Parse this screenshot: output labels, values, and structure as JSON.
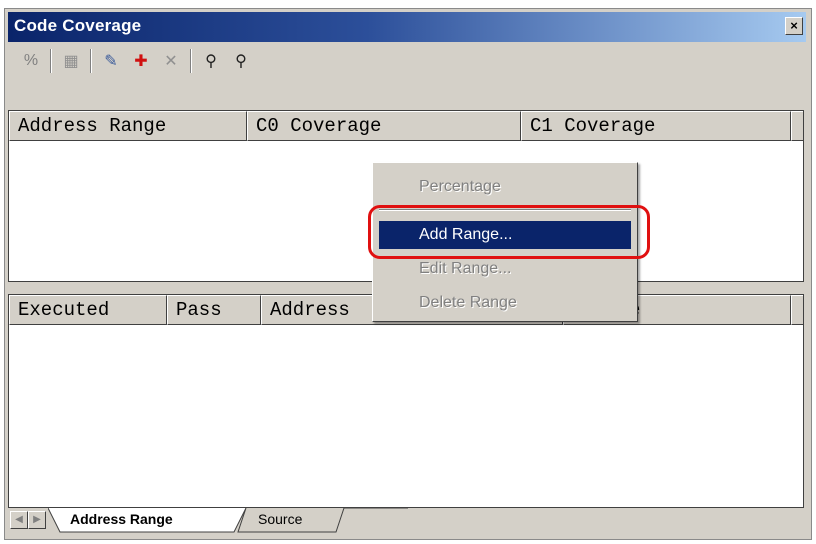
{
  "window": {
    "title": "Code Coverage",
    "close_glyph": "×"
  },
  "toolbar": {
    "buttons": [
      {
        "icon": "percent-icon",
        "glyph": "%"
      },
      {
        "icon": "code-map-icon",
        "glyph": "▦"
      },
      {
        "icon": "edit-range-icon",
        "glyph": "✎"
      },
      {
        "icon": "add-range-icon",
        "glyph": "✚"
      },
      {
        "icon": "delete-range-icon",
        "glyph": "✕"
      },
      {
        "icon": "find-icon",
        "glyph": "⚲"
      },
      {
        "icon": "find-next-icon",
        "glyph": "⚲"
      }
    ]
  },
  "upper_table": {
    "columns": [
      "Address Range",
      "C0 Coverage",
      "C1 Coverage"
    ]
  },
  "lower_table": {
    "columns": [
      "Executed",
      "Pass",
      "Address",
      "Source"
    ]
  },
  "context_menu": {
    "items": [
      "Percentage",
      "Add Range...",
      "Edit Range...",
      "Delete Range"
    ],
    "active_item": "Add Range..."
  },
  "tabs": {
    "items": [
      "Address Range",
      "Source"
    ],
    "selected": "Address Range"
  },
  "colors": {
    "title_start": "#0a246a",
    "title_end": "#a6caf0",
    "highlight": "#e01010",
    "menu_active": "#0a246a"
  }
}
